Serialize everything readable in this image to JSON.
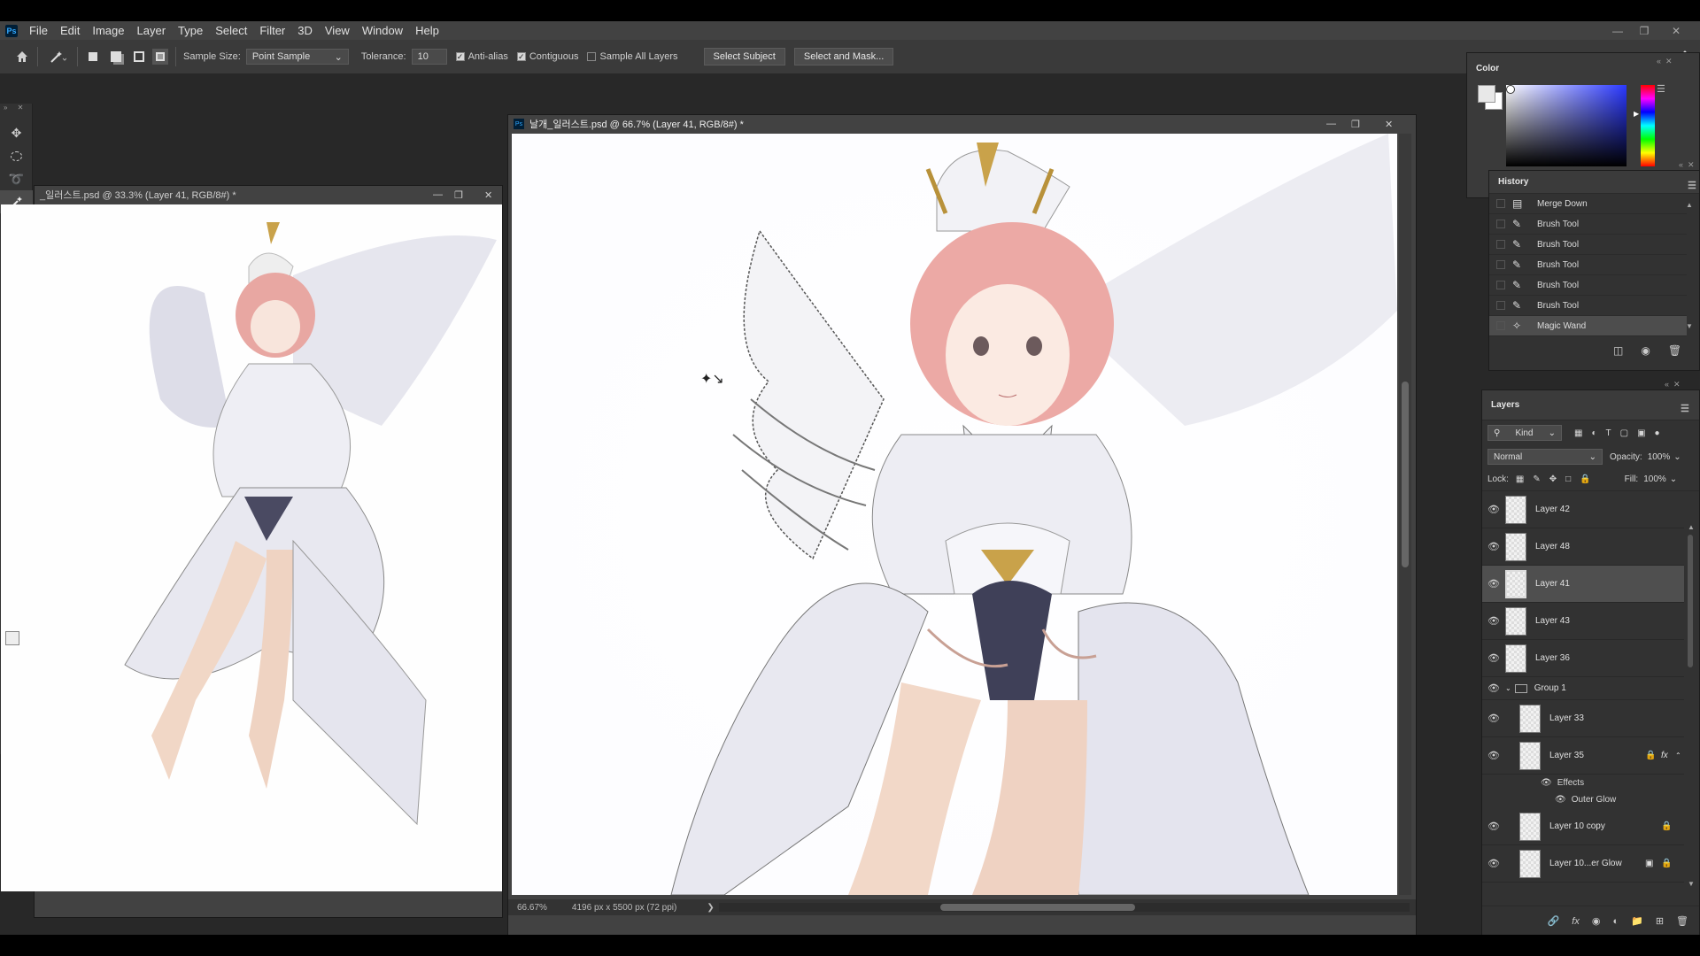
{
  "menubar": {
    "logo": "Ps",
    "items": [
      "File",
      "Edit",
      "Image",
      "Layer",
      "Type",
      "Select",
      "Filter",
      "3D",
      "View",
      "Window",
      "Help"
    ]
  },
  "options": {
    "sample_size_label": "Sample Size:",
    "sample_size_value": "Point Sample",
    "tolerance_label": "Tolerance:",
    "tolerance_value": "10",
    "anti_alias": "Anti-alias",
    "contiguous": "Contiguous",
    "sample_all_layers": "Sample All Layers",
    "select_subject": "Select Subject",
    "select_and_mask": "Select and Mask..."
  },
  "doc_left": {
    "title": "_일러스트.psd @ 33.3% (Layer 41, RGB/8#) *"
  },
  "doc_main": {
    "title": "날개_일러스트.psd @ 66.7% (Layer 41, RGB/8#) *",
    "zoom": "66.67%",
    "doc_info": "4196 px x 5500 px (72 ppi)"
  },
  "color_panel": {
    "title": "Color"
  },
  "history_panel": {
    "title": "History",
    "items": [
      {
        "label": "Merge Down",
        "icon": "document-icon"
      },
      {
        "label": "Brush Tool",
        "icon": "brush-icon"
      },
      {
        "label": "Brush Tool",
        "icon": "brush-icon"
      },
      {
        "label": "Brush Tool",
        "icon": "brush-icon"
      },
      {
        "label": "Brush Tool",
        "icon": "brush-icon"
      },
      {
        "label": "Brush Tool",
        "icon": "brush-icon"
      },
      {
        "label": "Magic Wand",
        "icon": "magic-wand-icon"
      }
    ]
  },
  "layers_panel": {
    "title": "Layers",
    "filter_kind": "Kind",
    "blend_mode": "Normal",
    "opacity_label": "Opacity:",
    "opacity_value": "100%",
    "lock_label": "Lock:",
    "fill_label": "Fill:",
    "fill_value": "100%",
    "layers": [
      {
        "name": "Layer 42"
      },
      {
        "name": "Layer 48"
      },
      {
        "name": "Layer 41"
      },
      {
        "name": "Layer 43"
      },
      {
        "name": "Layer 36"
      }
    ],
    "group_name": "Group 1",
    "group_layers": [
      {
        "name": "Layer 33"
      },
      {
        "name": "Layer 35"
      }
    ],
    "effects_label": "Effects",
    "outer_glow_label": "Outer Glow",
    "tail_layers": [
      {
        "name": "Layer 10 copy"
      },
      {
        "name": "Layer 10...er Glow"
      }
    ],
    "fx_label": "fx"
  },
  "colors": {
    "accent_hue": "#2a38ff",
    "panel_bg": "#323232",
    "hair": "#e8a0a0"
  }
}
